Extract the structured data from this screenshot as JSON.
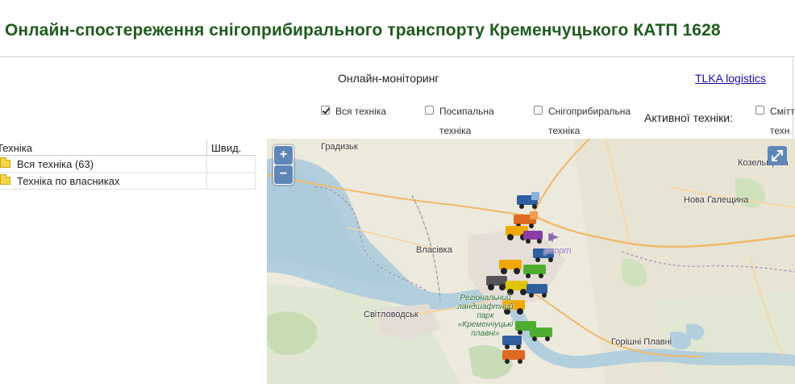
{
  "page_title": "Онлайн-спостереження снігоприбирального транспорту Кременчуцького КАТП 1628",
  "monitor": {
    "title": "Онлайн-моніторинг",
    "link": "TLKA logistics"
  },
  "filters": [
    {
      "line1": "Вся техніка",
      "line2": "",
      "checked": true
    },
    {
      "line1": "Посипальна",
      "line2": "техніка",
      "checked": false
    },
    {
      "line1": "Снігоприбиральна",
      "line2": "техніка",
      "checked": false
    },
    {
      "line1": "Смітт",
      "line2": "техн",
      "checked": false
    }
  ],
  "active_label": "Активної техніки:",
  "tree": {
    "col_name": "Техніка",
    "col_speed": "Швид.",
    "rows": [
      {
        "label": "Вся техніка (63)"
      },
      {
        "label": "Техніка по власниках"
      }
    ]
  },
  "map": {
    "zoom_in": "+",
    "zoom_out": "−",
    "labels": {
      "hradyzk": "Градизьк",
      "kozelshchyna": "Козельщина",
      "nova_halesh": "Нова Галещина",
      "vlasivka": "Власівка",
      "svitlovodsk": "Світловодськ",
      "horishni": "Горішні Плавні",
      "airport": "рпорт",
      "park": "Регіональний ландшафтний парк «Кременчуцькі плавні»"
    }
  }
}
